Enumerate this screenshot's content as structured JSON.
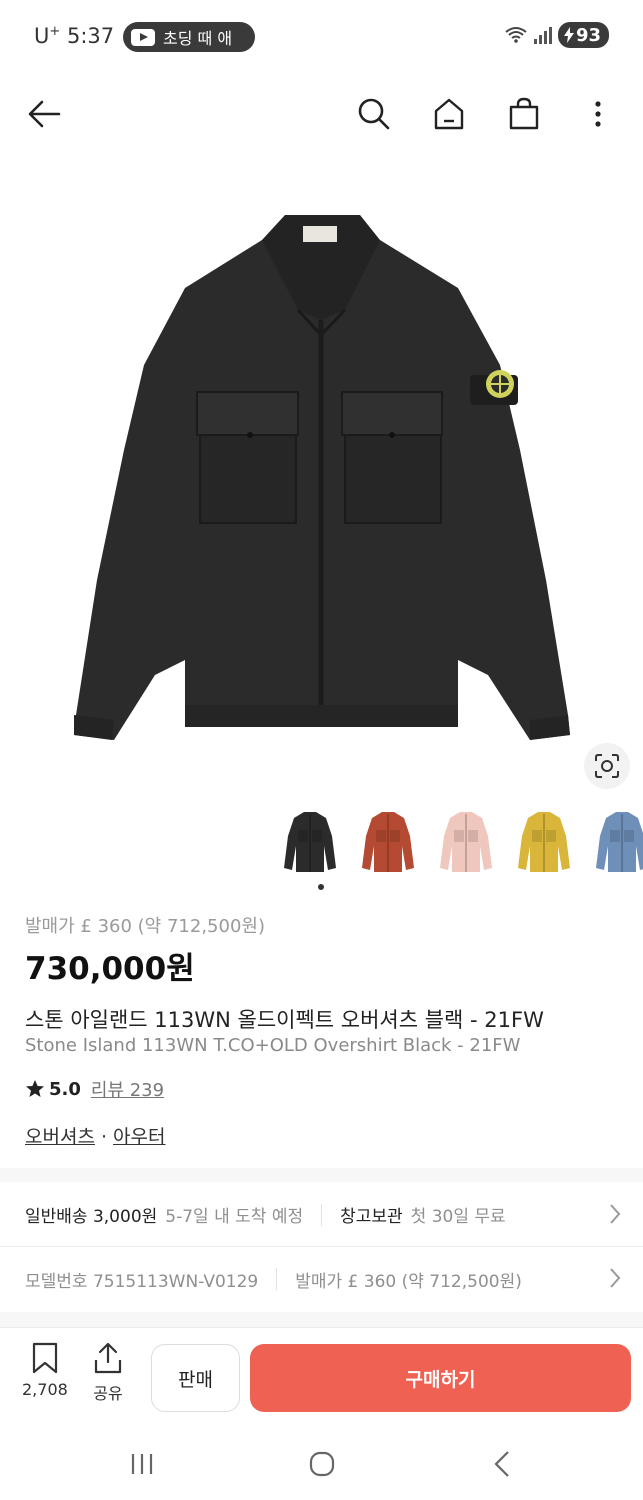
{
  "status_bar": {
    "carrier": "U",
    "carrier_plus": "+",
    "time": "5:37",
    "media_pill_text": "초딩 때 애",
    "battery": "93"
  },
  "nav": {
    "back_icon": "arrow-left-icon",
    "search_icon": "search-icon",
    "home_icon": "home-icon",
    "cart_icon": "shopping-bag-icon",
    "more_icon": "more-vertical-icon"
  },
  "product": {
    "color_options": [
      "black",
      "rust",
      "pink",
      "yellow",
      "blue"
    ],
    "thumb_colors": [
      "#2b2b2b",
      "#b44a32",
      "#f0c7bd",
      "#d9b53a",
      "#6e8fb8"
    ],
    "release_price": "발매가 £ 360 (약 712,500원)",
    "price": "730,000원",
    "title_ko": "스톤 아일랜드 113WN 올드이펙트 오버셔츠 블랙 - 21FW",
    "title_en": "Stone Island 113WN T.CO+OLD Overshirt Black - 21FW",
    "rating": "5.0",
    "reviews": "리뷰 239",
    "category_1": "오버셔츠",
    "category_sep": " · ",
    "category_2": "아우터"
  },
  "shipping": {
    "delivery_label": "일반배송 3,000원",
    "delivery_eta": "5-7일 내 도착 예정",
    "storage_label": "창고보관",
    "storage_desc": "첫 30일 무료"
  },
  "details": {
    "model_label": "모델번호 7515113WN-V0129",
    "release_label": "발매가 £ 360 (약 712,500원)"
  },
  "bottom_bar": {
    "wishlist_count": "2,708",
    "share_label": "공유",
    "sell_label": "판매",
    "buy_label": "구매하기"
  },
  "colors": {
    "accent": "#ef6253",
    "jacket": "#2b2b2b"
  }
}
